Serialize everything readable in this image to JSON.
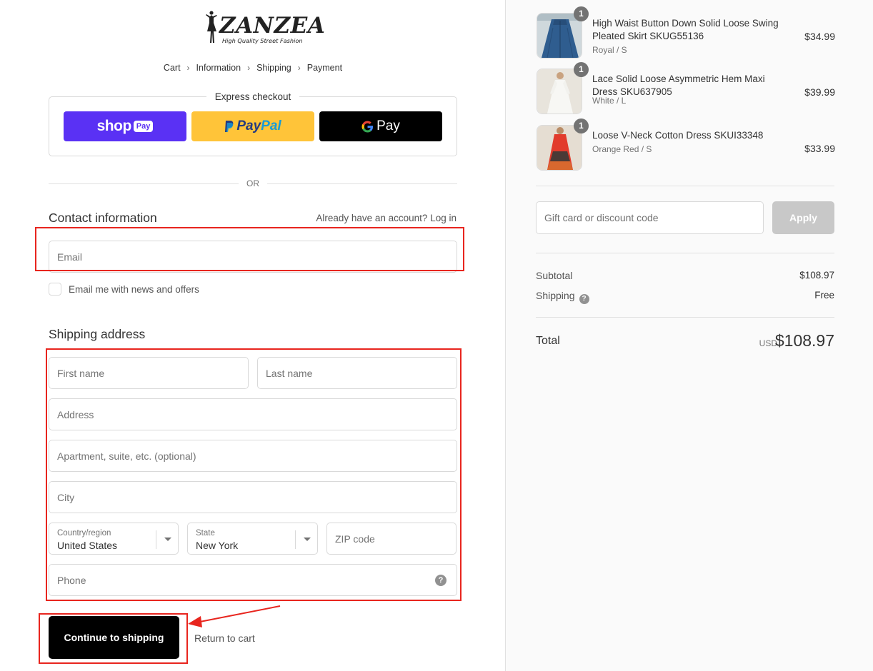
{
  "brand": {
    "name": "ZANZEA",
    "tagline": "High Quality Street Fashion"
  },
  "breadcrumb": [
    {
      "label": "Cart"
    },
    {
      "label": "Information"
    },
    {
      "label": "Shipping"
    },
    {
      "label": "Payment"
    }
  ],
  "express": {
    "title": "Express checkout",
    "shop_pay": {
      "word": "shop",
      "pill": "Pay",
      "color": "#5a31f4"
    },
    "paypal": {
      "word1": "Pay",
      "word2": "Pal",
      "color": "#ffc439"
    },
    "gpay": {
      "letter": "G",
      "word": "Pay"
    }
  },
  "or_text": "OR",
  "contact": {
    "title": "Contact information",
    "login_prompt": "Already have an account?",
    "login_link": "Log in",
    "email_placeholder": "Email",
    "newsletter_label": "Email me with news and offers"
  },
  "shipping": {
    "title": "Shipping address",
    "first_name_placeholder": "First name",
    "last_name_placeholder": "Last name",
    "address_placeholder": "Address",
    "apartment_placeholder": "Apartment, suite, etc. (optional)",
    "city_placeholder": "City",
    "country_label": "Country/region",
    "country_value": "United States",
    "state_label": "State",
    "state_value": "New York",
    "zip_placeholder": "ZIP code",
    "phone_placeholder": "Phone",
    "help_glyph": "?"
  },
  "actions": {
    "continue_label": "Continue to shipping",
    "return_label": "Return to cart"
  },
  "products": [
    {
      "qty": "1",
      "name": "High Waist Button Down Solid Loose Swing Pleated Skirt SKUG55136",
      "variant": "Royal / S",
      "price": "$34.99"
    },
    {
      "qty": "1",
      "name": "Lace Solid Loose Asymmetric Hem Maxi Dress SKU637905",
      "variant": "White / L",
      "price": "$39.99"
    },
    {
      "qty": "1",
      "name": "Loose V-Neck Cotton Dress SKUI33348",
      "variant": "Orange Red / S",
      "price": "$33.99"
    }
  ],
  "discount": {
    "placeholder": "Gift card or discount code",
    "apply_label": "Apply"
  },
  "summary": {
    "subtotal_label": "Subtotal",
    "subtotal_value": "$108.97",
    "shipping_label": "Shipping",
    "shipping_value": "Free",
    "total_label": "Total",
    "currency": "USD",
    "total_value": "$108.97"
  },
  "colors": {
    "annotation": "#e8251e",
    "primary_button": "#000000",
    "apply_disabled": "#c8c8c8"
  }
}
